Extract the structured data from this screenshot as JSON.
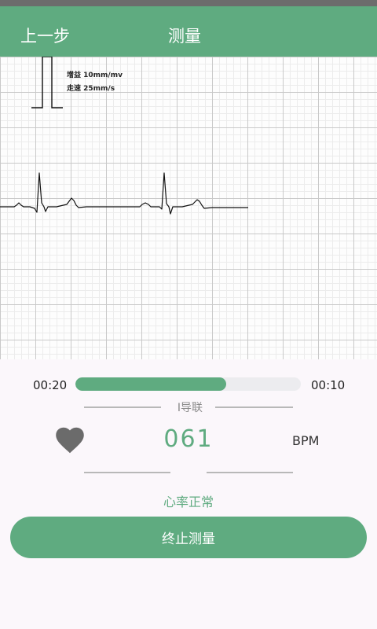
{
  "header": {
    "back_label": "上一步",
    "title": "测量"
  },
  "ecg": {
    "gain": "增益 10mm/mv",
    "speed": "走速 25mm/s"
  },
  "progress": {
    "elapsed": "00:20",
    "remaining": "00:10",
    "fraction": 0.67
  },
  "lead": {
    "label": "I导联"
  },
  "heart_rate": {
    "icon": "heart-icon",
    "value": "061",
    "unit": "BPM",
    "status": "心率正常"
  },
  "actions": {
    "stop_label": "终止测量"
  },
  "colors": {
    "accent": "#5fab80",
    "statusbar": "#6c6c6c",
    "heart": "#6b6b6b"
  }
}
